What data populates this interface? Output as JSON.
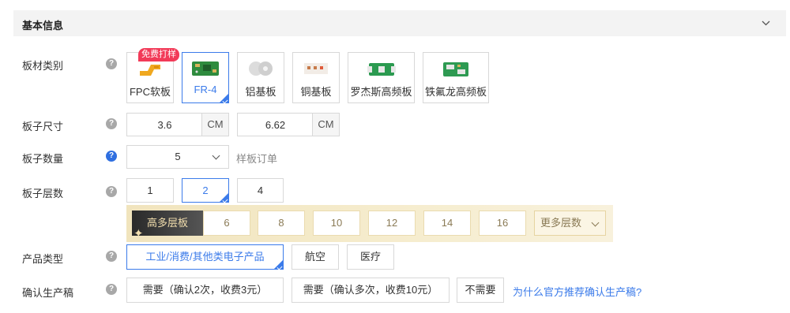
{
  "header": {
    "title": "基本信息"
  },
  "rows": {
    "material": {
      "label": "板材类别"
    },
    "size": {
      "label": "板子尺寸"
    },
    "quantity": {
      "label": "板子数量"
    },
    "layers": {
      "label": "板子层数"
    },
    "product": {
      "label": "产品类型"
    },
    "confirm": {
      "label": "确认生产稿"
    }
  },
  "help_icon": "?",
  "materials": [
    {
      "label": "FPC软板",
      "icon": "fpc-board-icon",
      "selected": false
    },
    {
      "label": "FR-4",
      "icon": "fr4-board-icon",
      "selected": true
    },
    {
      "label": "铝基板",
      "icon": "aluminum-board-icon",
      "selected": false
    },
    {
      "label": "铜基板",
      "icon": "copper-board-icon",
      "selected": false
    },
    {
      "label": "罗杰斯高频板",
      "icon": "rogers-board-icon",
      "selected": false
    },
    {
      "label": "铁氟龙高频板",
      "icon": "teflon-board-icon",
      "selected": false
    }
  ],
  "free_sample_badge": "免费打样",
  "size": {
    "width": "3.6",
    "height": "6.62",
    "unit": "CM"
  },
  "quantity": {
    "value": "5",
    "note": "样板订单"
  },
  "layers": {
    "options": [
      "1",
      "2",
      "4"
    ],
    "selected": "2",
    "premium_tag": "高多层板",
    "premium_options": [
      "6",
      "8",
      "10",
      "12",
      "14",
      "16"
    ],
    "more_label": "更多层数"
  },
  "product_types": [
    "工业/消费/其他类电子产品",
    "航空",
    "医疗"
  ],
  "product_selected": "工业/消费/其他类电子产品",
  "confirm_options": [
    "需要（确认2次，收费3元）",
    "需要（确认多次，收费10元）",
    "不需要"
  ],
  "confirm_link": "为什么官方推荐确认生产稿?",
  "colors": {
    "accent": "#3b7bea",
    "badge": "#f23a58",
    "gold": "#f3dfae"
  }
}
